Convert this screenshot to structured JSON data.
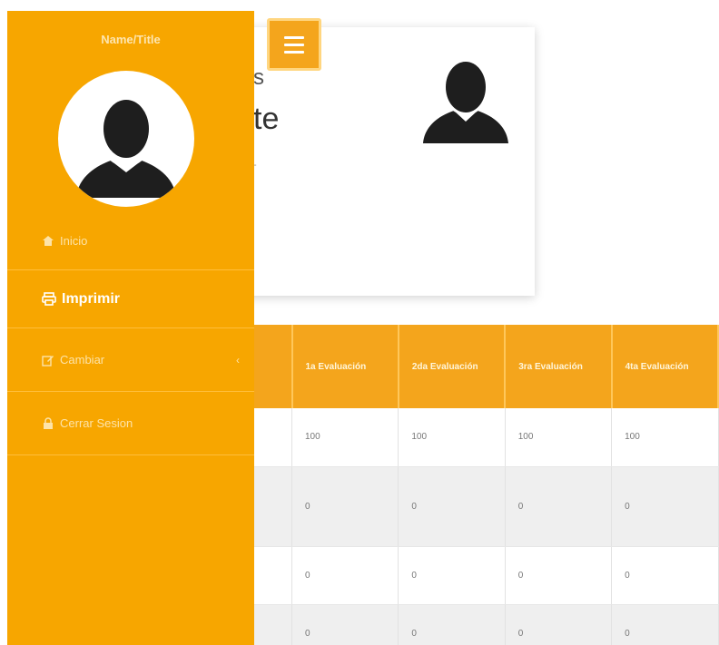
{
  "sidebar": {
    "user_name": "Name/Title",
    "items": [
      {
        "label": "Inicio",
        "icon": "home-icon"
      },
      {
        "label": "Imprimir",
        "icon": "print-icon"
      },
      {
        "label": "Cambiar",
        "icon": "edit-icon",
        "submenu_icon": "chevron-left-icon"
      },
      {
        "label": "Cerrar Sesion",
        "icon": "lock-icon"
      }
    ]
  },
  "main": {
    "menu_button_icon": "hamburger-menu-icon",
    "profile": {
      "title_fragment": "s",
      "subtitle_fragment": "te",
      "caption_fragment": "-"
    },
    "grades": {
      "headers": [
        "1a Evaluación",
        "2da Evaluación",
        "3ra Evaluación",
        "4ta Evaluación"
      ],
      "rows": [
        [
          "100",
          "100",
          "100",
          "100"
        ],
        [
          "0",
          "0",
          "0",
          "0"
        ],
        [
          "0",
          "0",
          "0",
          "0"
        ],
        [
          "0",
          "0",
          "0",
          "0"
        ]
      ]
    }
  },
  "colors": {
    "accent": "#f7a600",
    "accent_light": "#ffbe3b",
    "text_on_accent": "#ffffff"
  }
}
